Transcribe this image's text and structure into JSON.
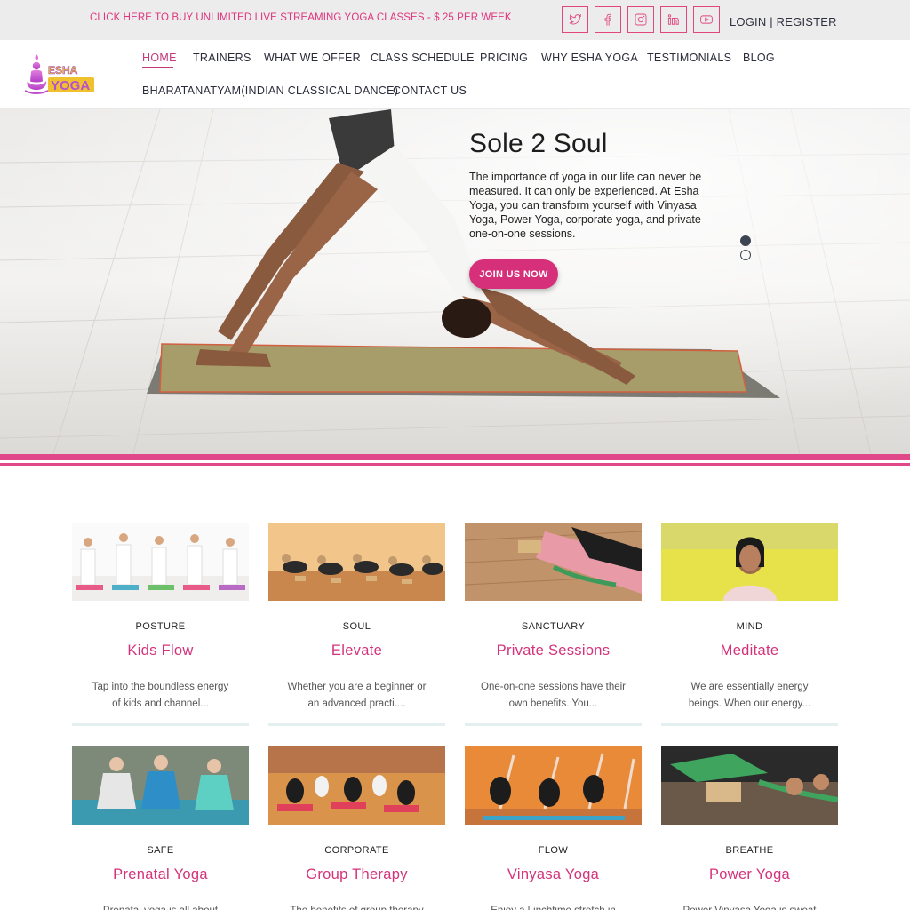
{
  "topbar": {
    "promo": "CLICK HERE TO BUY UNLIMITED LIVE STREAMING YOGA CLASSES - $ 25 PER WEEK",
    "socials": [
      "twitter-icon",
      "facebook-icon",
      "instagram-icon",
      "linkedin-icon",
      "youtube-icon"
    ],
    "login": "LOGIN",
    "separator": " | ",
    "register": "REGISTER"
  },
  "brand": {
    "logo_text": "ESHA YOGA"
  },
  "nav": {
    "items": [
      "HOME",
      "TRAINERS",
      "WHAT WE OFFER",
      "CLASS SCHEDULE",
      "PRICING",
      "WHY ESHA YOGA",
      "TESTIMONIALS",
      "BLOG",
      "BHARATANATYAM(INDIAN CLASSICAL DANCE)",
      "CONTACT US"
    ],
    "active": "HOME"
  },
  "hero": {
    "title": "Sole 2 Soul",
    "description": "The importance of yoga in our life can never be measured. It can only be experienced. At Esha Yoga, you can transform yourself with Vinyasa Yoga, Power Yoga, corporate yoga, and private one-on-one sessions.",
    "button": "JOIN US NOW",
    "slides_total": 2,
    "slide_active": 1
  },
  "cards": [
    {
      "category": "POSTURE",
      "title": "Kids Flow",
      "desc": "Tap into the boundless energy of kids and channel..."
    },
    {
      "category": "SOUL",
      "title": "Elevate",
      "desc": "Whether you are a beginner or an advanced practi...."
    },
    {
      "category": "SANCTUARY",
      "title": "Private Sessions",
      "desc": "One-on-one sessions have their own benefits. You..."
    },
    {
      "category": "MIND",
      "title": "Meditate",
      "desc": "We are essentially energy beings. When our energy..."
    },
    {
      "category": "SAFE",
      "title": "Prenatal Yoga",
      "desc": "Prenatal yoga is all about"
    },
    {
      "category": "CORPORATE",
      "title": "Group Therapy",
      "desc": "The benefits of group therapy"
    },
    {
      "category": "FLOW",
      "title": "Vinyasa Yoga",
      "desc": "Enjoy a lunchtime stretch in"
    },
    {
      "category": "BREATHE",
      "title": "Power Yoga",
      "desc": "Power Vinyasa Yoga is sweat"
    }
  ],
  "colors": {
    "accent": "#d4337b",
    "topbar_bg": "#ececec",
    "nav_text": "#2a2c3a"
  }
}
